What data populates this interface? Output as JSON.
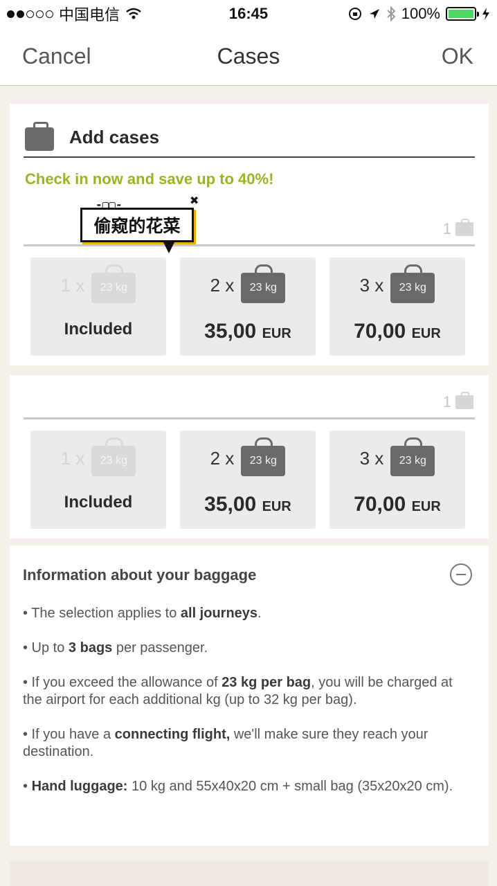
{
  "status_bar": {
    "carrier": "中国电信",
    "time": "16:45",
    "battery": "100%"
  },
  "nav": {
    "cancel": "Cancel",
    "title": "Cases",
    "ok": "OK"
  },
  "add_cases": {
    "title": "Add cases",
    "promo": "Check in now and save up to 40%!"
  },
  "sticker": {
    "text": "偷窥的花菜"
  },
  "passengers": [
    {
      "name": "",
      "count": "1",
      "options": [
        {
          "qty": "1 x",
          "weight": "23 kg",
          "label": "Included"
        },
        {
          "qty": "2 x",
          "weight": "23 kg",
          "price": "35,00",
          "currency": "EUR"
        },
        {
          "qty": "3 x",
          "weight": "23 kg",
          "price": "70,00",
          "currency": "EUR"
        }
      ]
    },
    {
      "name": "",
      "count": "1",
      "options": [
        {
          "qty": "1 x",
          "weight": "23 kg",
          "label": "Included"
        },
        {
          "qty": "2 x",
          "weight": "23 kg",
          "price": "35,00",
          "currency": "EUR"
        },
        {
          "qty": "3 x",
          "weight": "23 kg",
          "price": "70,00",
          "currency": "EUR"
        }
      ]
    }
  ],
  "info": {
    "title": "Information about your baggage",
    "items": [
      {
        "a": "• The selection applies to ",
        "b": "all journeys",
        "c": "."
      },
      {
        "a": "• Up to ",
        "b": "3 bags",
        "c": " per passenger."
      },
      {
        "a": "• If you exceed the allowance of ",
        "b": "23 kg per bag",
        "c": ", you will be charged at the airport for each additional kg (up to 32 kg per bag)."
      },
      {
        "a": "• If you have a ",
        "b": "connecting flight,",
        "c": " we'll make sure they reach your destination."
      },
      {
        "a": "• ",
        "b": "Hand luggage:",
        "c": " 10 kg and 55x40x20 cm + small bag (35x20x20 cm)."
      }
    ]
  },
  "colors": {
    "promo": "#9ab31e",
    "battery": "#4cd964",
    "bag": "#6a6a6a"
  }
}
